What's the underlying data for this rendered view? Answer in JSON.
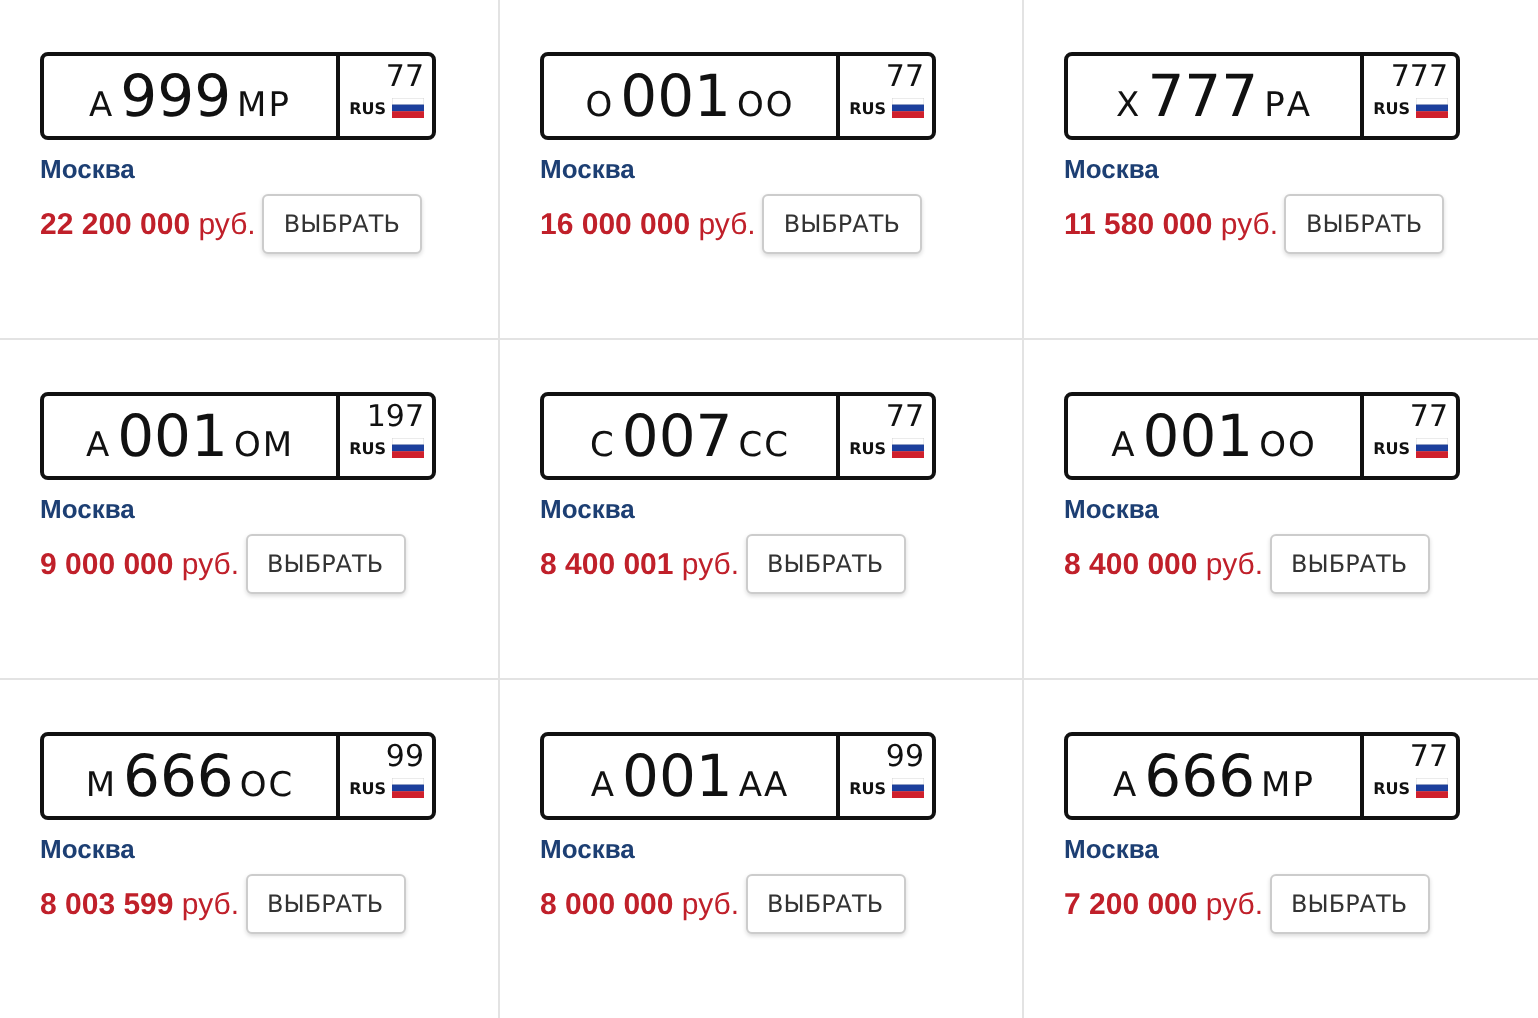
{
  "listings": [
    {
      "plate": {
        "series_left": "А",
        "number": "999",
        "series_right": "МР",
        "region": "77",
        "country": "RUS"
      },
      "city": "Москва",
      "price": "**22 200 000** руб.",
      "button": "ВЫБРАТЬ"
    },
    {
      "plate": {
        "series_left": "О",
        "number": "001",
        "series_right": "ОО",
        "region": "77",
        "country": "RUS"
      },
      "city": "Москва",
      "price": "**16 000 000** руб.",
      "button": "ВЫБРАТЬ"
    },
    {
      "plate": {
        "series_left": "Х",
        "number": "777",
        "series_right": "РА",
        "region": "777",
        "country": "RUS"
      },
      "city": "Москва",
      "price": "**11 580 000** руб.",
      "button": "ВЫБРАТЬ"
    },
    {
      "plate": {
        "series_left": "А",
        "number": "001",
        "series_right": "ОМ",
        "region": "197",
        "country": "RUS"
      },
      "city": "Москва",
      "price": "**9 000 000** руб.",
      "button": "ВЫБРАТЬ"
    },
    {
      "plate": {
        "series_left": "С",
        "number": "007",
        "series_right": "СС",
        "region": "77",
        "country": "RUS"
      },
      "city": "Москва",
      "price": "**8 400 001** руб.",
      "button": "ВЫБРАТЬ"
    },
    {
      "plate": {
        "series_left": "А",
        "number": "001",
        "series_right": "ОО",
        "region": "77",
        "country": "RUS"
      },
      "city": "Москва",
      "price": "**8 400 000** руб.",
      "button": "ВЫБРАТЬ"
    },
    {
      "plate": {
        "series_left": "М",
        "number": "666",
        "series_right": "ОС",
        "region": "99",
        "country": "RUS"
      },
      "city": "Москва",
      "price": "**8 003 599** руб.",
      "button": "ВЫБРАТЬ"
    },
    {
      "plate": {
        "series_left": "А",
        "number": "001",
        "series_right": "АА",
        "region": "99",
        "country": "RUS"
      },
      "city": "Москва",
      "price": "**8 000 000** руб.",
      "button": "ВЫБРАТЬ"
    },
    {
      "plate": {
        "series_left": "А",
        "number": "666",
        "series_right": "МР",
        "region": "77",
        "country": "RUS"
      },
      "city": "Москва",
      "price": "**7 200 000** руб.",
      "button": "ВЫБРАТЬ"
    }
  ]
}
